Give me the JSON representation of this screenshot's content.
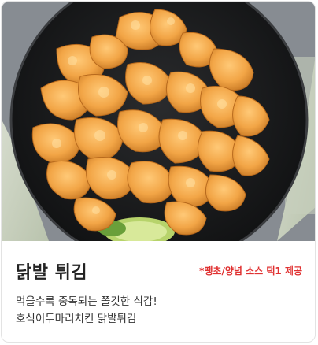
{
  "product": {
    "image_alt": "",
    "title": "닭발 튀김",
    "badge": "*땡초/양념 소스 택1 제공",
    "description_lines": [
      "먹을수록 중독되는 쫄깃한 식감!",
      "호식이두마리치킨 닭발튀김"
    ]
  },
  "colors": {
    "badge": "#e03131",
    "title": "#222222",
    "text": "#333333"
  }
}
